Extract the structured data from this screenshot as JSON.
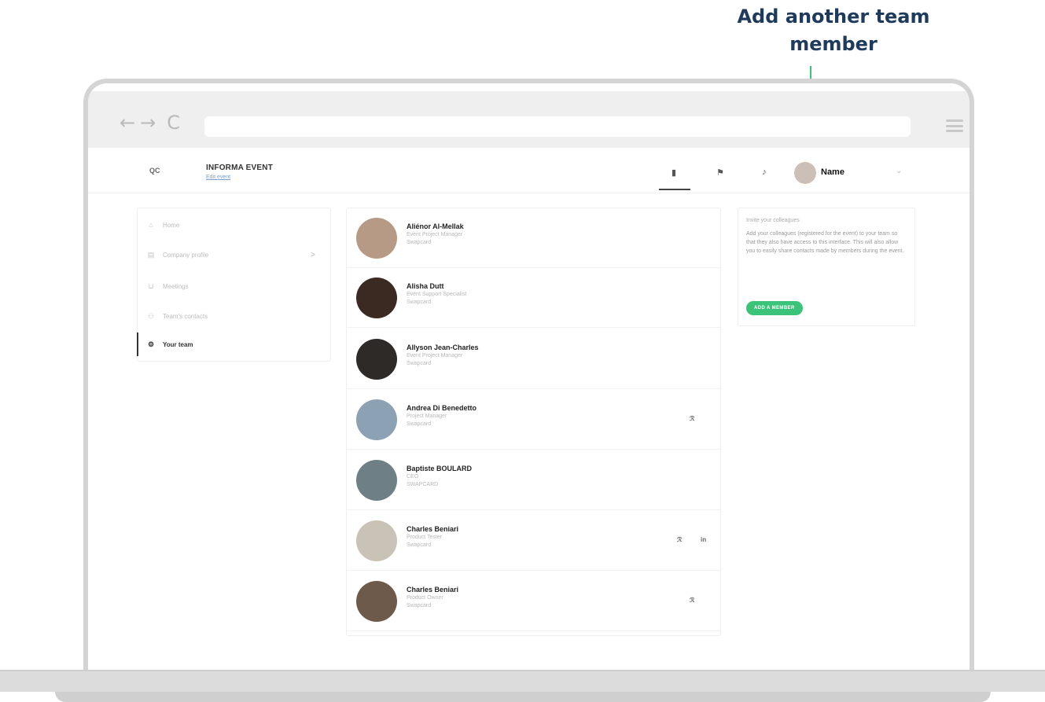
{
  "annotation": {
    "title_line1": "Add another team",
    "title_line2": "member"
  },
  "browser": {
    "back": "←",
    "forward": "→",
    "reload": "C"
  },
  "header": {
    "logo": "QC",
    "event_name": "INFORMA EVENT",
    "event_sub": "Edit event",
    "user_name": "Name",
    "caret": "⌄"
  },
  "sidebar": {
    "items": [
      {
        "icon": "home-icon",
        "glyph": "⌂",
        "label": "Home",
        "active": false
      },
      {
        "icon": "company-icon",
        "glyph": "▤",
        "label": "Company profile",
        "active": false,
        "chevron": ">"
      },
      {
        "icon": "meetings-icon",
        "glyph": "⊔",
        "label": "Meetings",
        "active": false
      },
      {
        "icon": "contacts-icon",
        "glyph": "⚇",
        "label": "Team's contacts",
        "active": false
      },
      {
        "icon": "team-icon",
        "glyph": "⚙",
        "label": "Your team",
        "active": true
      }
    ]
  },
  "team": {
    "members": [
      {
        "name": "Aliénor Al-Mellak",
        "role": "Event Project Manager",
        "org": "Swapcard",
        "avatar_color": "#b79a86"
      },
      {
        "name": "Alisha Dutt",
        "role": "Event Support Specialist",
        "org": "Swapcard",
        "avatar_color": "#3a2a22"
      },
      {
        "name": "Allyson Jean-Charles",
        "role": "Event Project Manager",
        "org": "Swapcard",
        "avatar_color": "#2e2a28"
      },
      {
        "name": "Andrea Di Benedetto",
        "role": "Project Manager",
        "org": "Swapcard",
        "avatar_color": "#8da1b4",
        "actions": [
          "ℛ"
        ]
      },
      {
        "name": "Baptiste BOULARD",
        "role": "CEO",
        "org": "SWAPCARD",
        "avatar_color": "#6f7f86"
      },
      {
        "name": "Charles Beniari",
        "role": "Product Tester",
        "org": "Swapcard",
        "avatar_color": "#c9c2b6",
        "actions": [
          "ℛ",
          "in"
        ]
      },
      {
        "name": "Charles Beniari",
        "role": "Product Owner",
        "org": "Swapcard",
        "avatar_color": "#6d5a4a",
        "actions": [
          "ℛ"
        ]
      }
    ]
  },
  "invite": {
    "title": "Invite your colleagues",
    "text": "Add your colleagues (registered for the event) to your team so that they also have access to this interface. This will also allow you to easily share contacts made by members during the event.",
    "button": "ADD A MEMBER"
  },
  "colors": {
    "accent": "#3cc37a",
    "annotation_text": "#1e3a5c"
  }
}
